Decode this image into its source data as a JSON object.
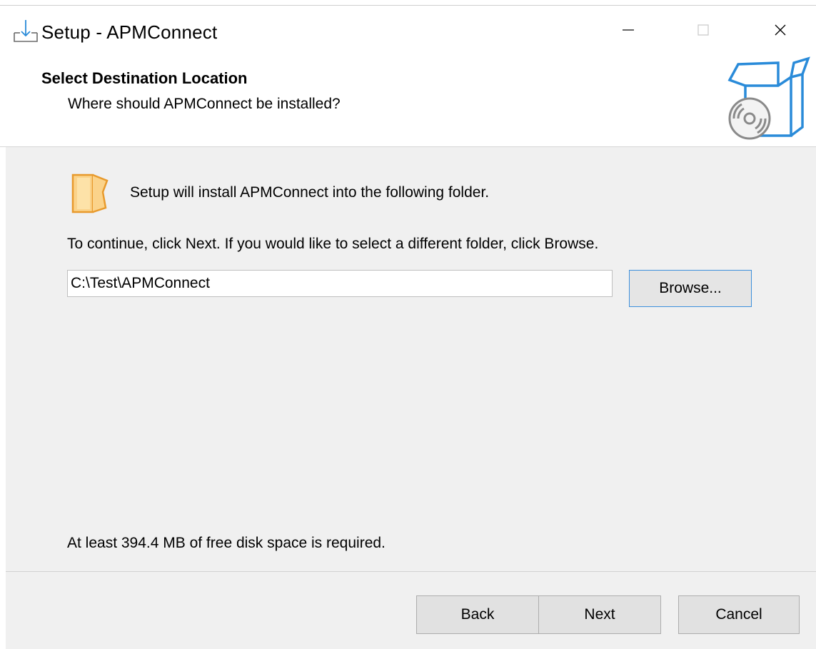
{
  "window": {
    "title": "Setup - APMConnect",
    "controls": {
      "minimize_icon": "minimize-icon",
      "maximize_icon": "maximize-icon",
      "close_icon": "close-icon"
    }
  },
  "header": {
    "title": "Select Destination Location",
    "subtitle": "Where should APMConnect be installed?",
    "graphic_icon": "setup-box-disc-icon"
  },
  "body": {
    "intro": "Setup will install APMConnect into the following folder.",
    "instruction": "To continue, click Next. If you would like to select a different folder, click Browse.",
    "folder_path": "C:\\Test\\APMConnect",
    "browse_label": "Browse...",
    "disk_space": "At least 394.4 MB of free disk space is required."
  },
  "footer": {
    "back_label": "Back",
    "next_label": "Next",
    "cancel_label": "Cancel"
  },
  "colors": {
    "panel_bg": "#f0f0f0",
    "accent_blue": "#2a8bd9",
    "folder_orange": "#f6a93b",
    "button_bg": "#e1e1e1"
  }
}
